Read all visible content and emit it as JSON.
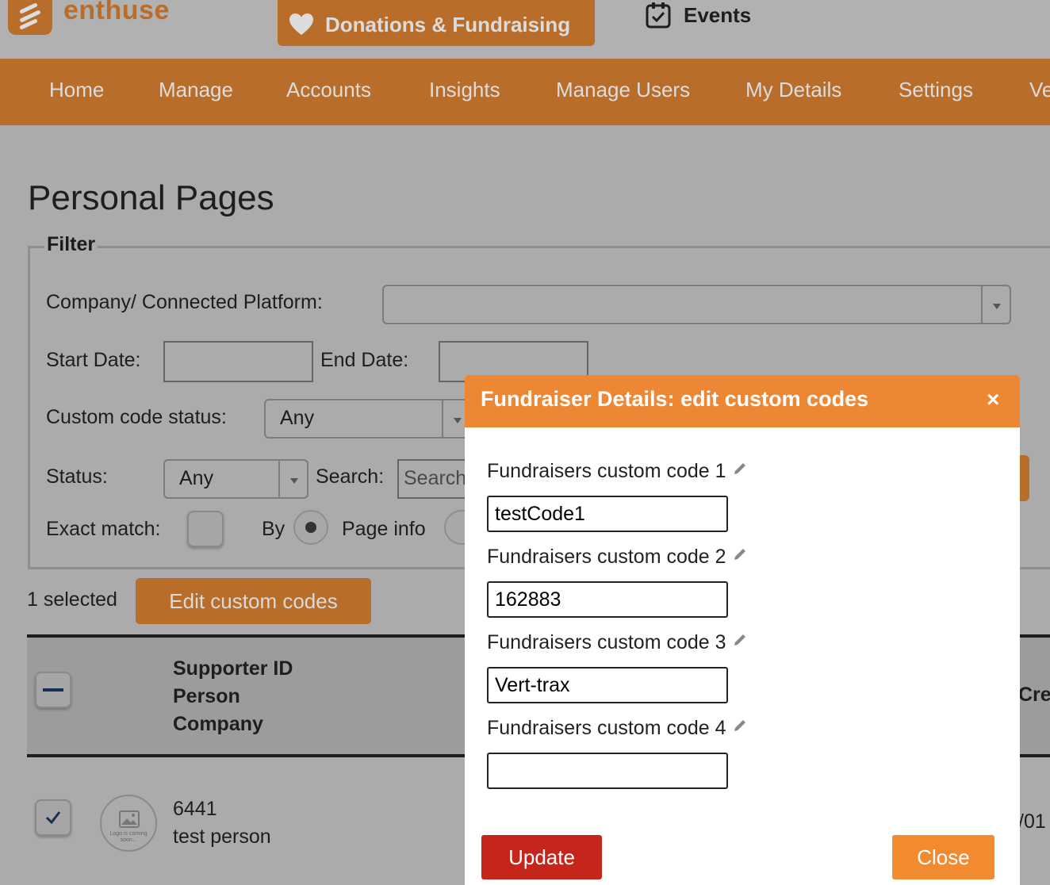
{
  "header": {
    "logo_text": "enthuse",
    "tabs": [
      {
        "label": "Donations & Fundraising",
        "icon": "heart-icon"
      },
      {
        "label": "Events",
        "icon": "calendar-check-icon"
      }
    ]
  },
  "nav": {
    "items": [
      "Home",
      "Manage",
      "Accounts",
      "Insights",
      "Manage Users",
      "My Details",
      "Settings",
      "Ve"
    ]
  },
  "page": {
    "title": "Personal Pages",
    "filter": {
      "legend": "Filter",
      "company_label": "Company/ Connected Platform:",
      "company_value": "",
      "start_date_label": "Start Date:",
      "end_date_label": "End Date:",
      "custom_code_status_label": "Custom code status:",
      "custom_code_status_value": "Any",
      "status_label": "Status:",
      "status_value": "Any",
      "search_label": "Search:",
      "search_placeholder": "Search",
      "exact_match_label": "Exact match:",
      "by_label": "By",
      "page_info_label": "Page info"
    },
    "selection": {
      "count_text": "1 selected",
      "edit_button": "Edit custom codes"
    },
    "table": {
      "headers": [
        "Supporter ID",
        "Person",
        "Company"
      ],
      "right_header_fragment": "Cre",
      "rows": [
        {
          "supporter_id": "6441",
          "person": "test person",
          "date_fragment": "/01",
          "logo_placeholder": "Logo is coming soon..."
        }
      ]
    }
  },
  "modal": {
    "title": "Fundraiser Details: edit custom codes",
    "close_symbol": "×",
    "fields": [
      {
        "label": "Fundraisers custom code 1",
        "value": "testCode1"
      },
      {
        "label": "Fundraisers custom code 2",
        "value": "162883"
      },
      {
        "label": "Fundraisers custom code 3",
        "value": "Vert-trax"
      },
      {
        "label": "Fundraisers custom code 4",
        "value": ""
      }
    ],
    "update_button": "Update",
    "close_button": "Close"
  },
  "colors": {
    "brand_orange": "#b86d2a",
    "modal_header": "#ee8734",
    "update_red": "#c4261c",
    "close_orange": "#f28a30"
  }
}
